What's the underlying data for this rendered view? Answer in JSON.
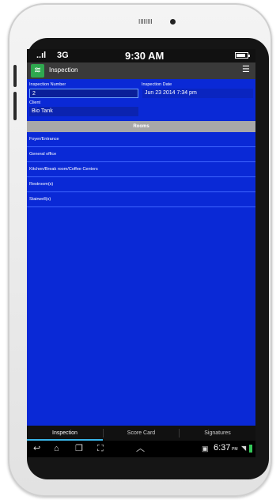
{
  "device": {
    "speaker_glyph": "IIIIIIII"
  },
  "status_bar": {
    "signal_glyph": "..ıl",
    "network": "3G",
    "time": "9:30 AM",
    "battery_level": 0.85
  },
  "action_bar": {
    "app_icon_glyph": "≋",
    "title": "Inspection",
    "menu_glyph": "☰"
  },
  "form": {
    "inspection_number_label": "Inspection Number",
    "inspection_number_value": "2",
    "inspection_date_label": "Inspection Date",
    "inspection_date_value": "Jun 23 2014 7:34 pm",
    "client_label": "Client",
    "client_value": "Bio Tank"
  },
  "rooms": {
    "header": "Rooms",
    "items": [
      "Foyer/Entrance",
      "General office",
      "Kitchen/Break room/Coffee Centers",
      "Restroom(s)",
      "Stairwell(s)"
    ]
  },
  "tabs": [
    {
      "label": "Inspection",
      "active": true
    },
    {
      "label": "Score Card",
      "active": false
    },
    {
      "label": "Signatures",
      "active": false
    }
  ],
  "nav_bar": {
    "back_glyph": "↩",
    "home_glyph": "⌂",
    "recent_glyph": "❐",
    "screenshot_glyph": "⛶",
    "up_glyph": "︿",
    "gallery_glyph": "▣",
    "time": "6:37",
    "ampm": "PM",
    "wifi_glyph": "◥"
  },
  "colors": {
    "background": "#0a29d6",
    "tab_indicator": "#39b5e8",
    "rooms_header": "#a8a8a8"
  }
}
